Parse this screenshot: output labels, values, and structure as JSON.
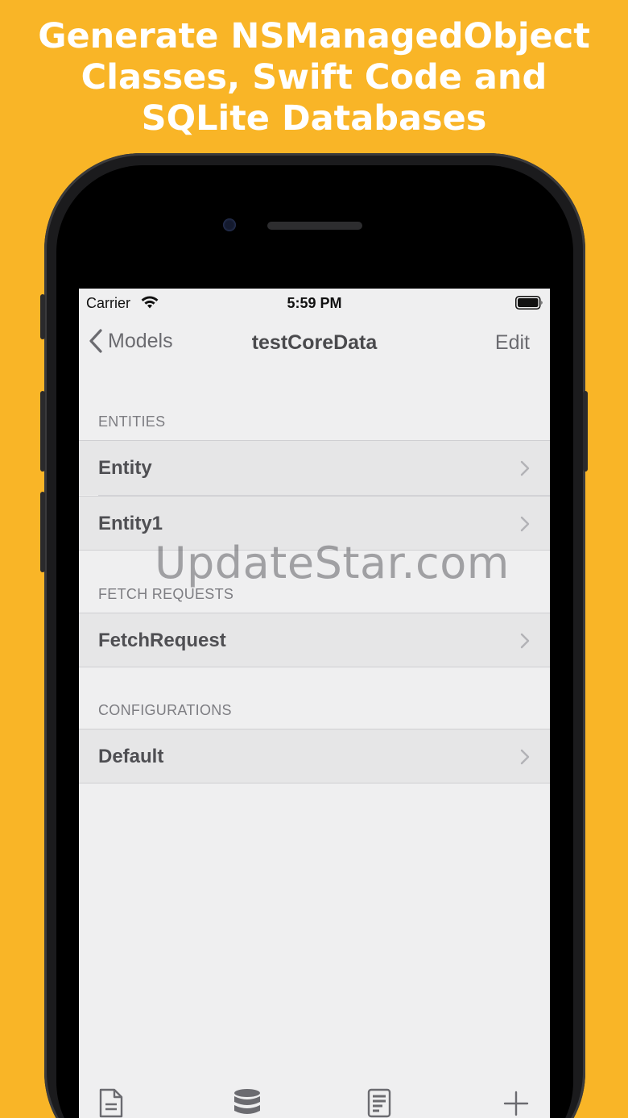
{
  "headline": {
    "line1": "Generate NSManagedObject",
    "line2": "Classes, Swift Code and",
    "line3": "SQLite Databases"
  },
  "status_bar": {
    "carrier": "Carrier",
    "time": "5:59 PM"
  },
  "nav": {
    "back_label": "Models",
    "title": "testCoreData",
    "edit_label": "Edit"
  },
  "sections": [
    {
      "header": "ENTITIES",
      "rows": [
        "Entity",
        "Entity1"
      ]
    },
    {
      "header": "FETCH REQUESTS",
      "rows": [
        "FetchRequest"
      ]
    },
    {
      "header": "CONFIGURATIONS",
      "rows": [
        "Default"
      ]
    }
  ],
  "watermark": "UpdateStar.com",
  "toolbar": {
    "icons": [
      "document-icon",
      "database-icon",
      "code-file-icon",
      "plus-icon"
    ]
  },
  "colors": {
    "background": "#F9B527",
    "screen_bg": "#EFEFF0",
    "row_bg": "#E6E6E7"
  }
}
